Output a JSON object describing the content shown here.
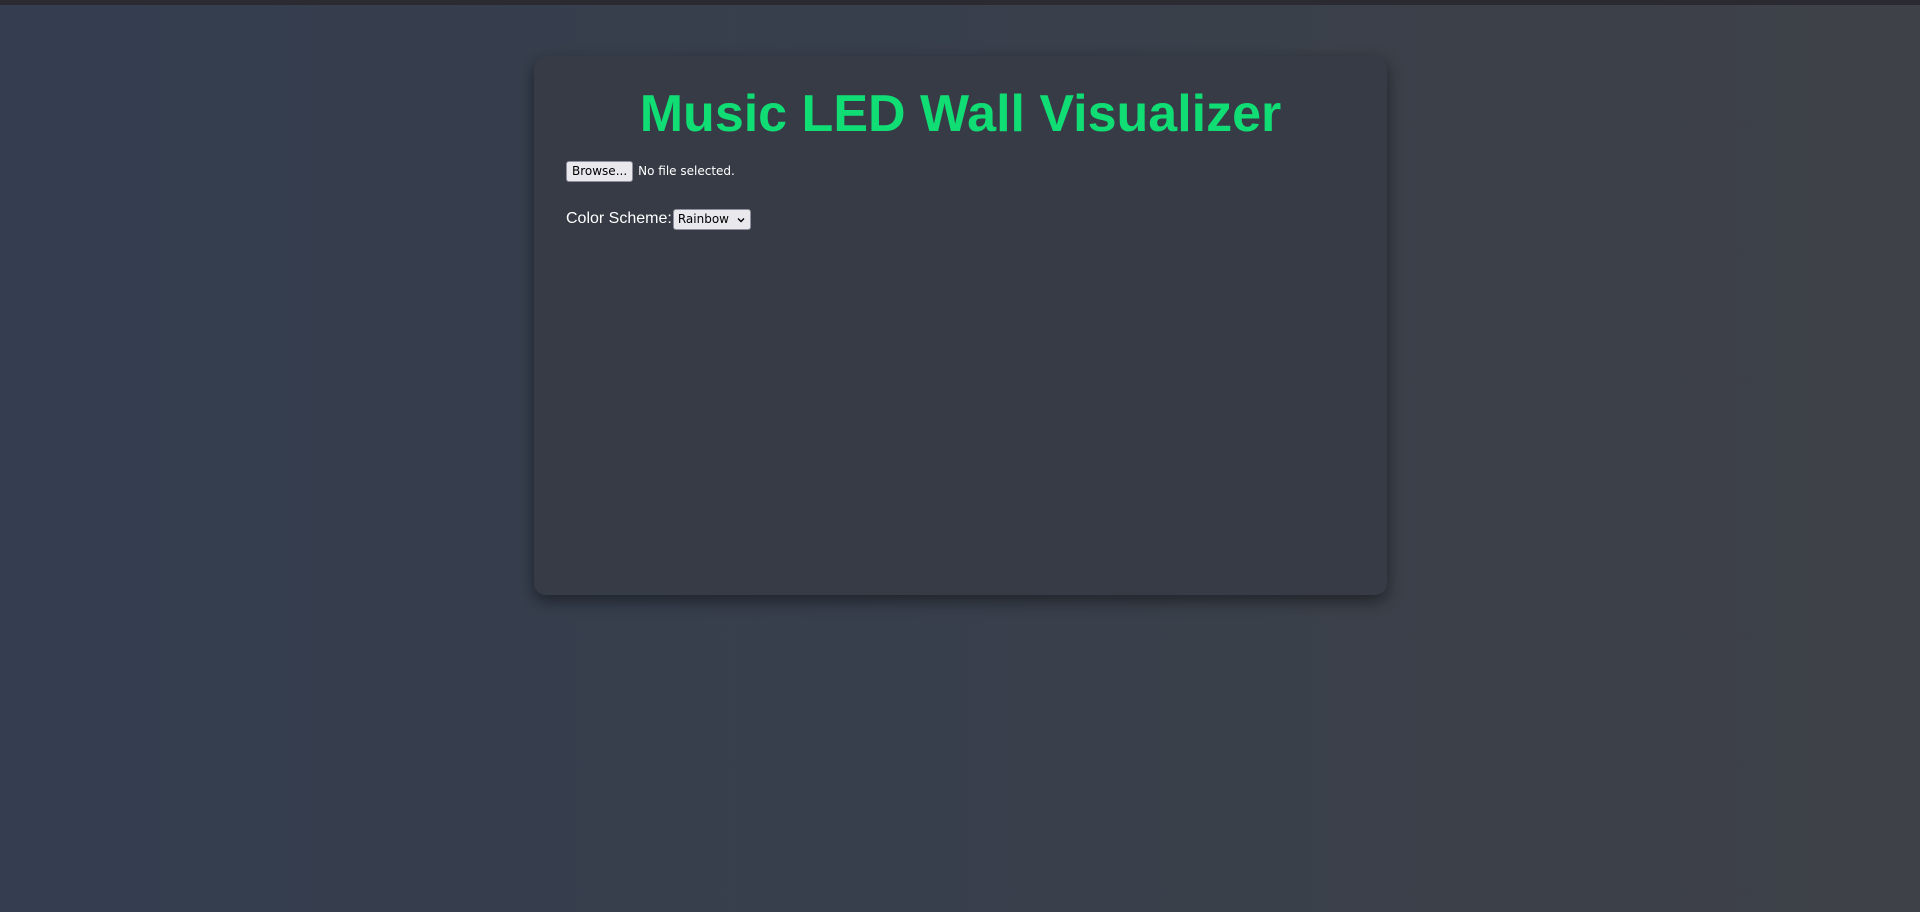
{
  "page": {
    "title": "Music LED Wall Visualizer"
  },
  "file_input": {
    "button_label": "Browse...",
    "status": "No file selected."
  },
  "color_scheme": {
    "label": "Color Scheme:",
    "selected": "Rainbow"
  },
  "colors": {
    "accent": "#10dd74",
    "card_background": "#363b45",
    "page_background_left": "#343e50",
    "page_background_right": "#3e4147"
  }
}
